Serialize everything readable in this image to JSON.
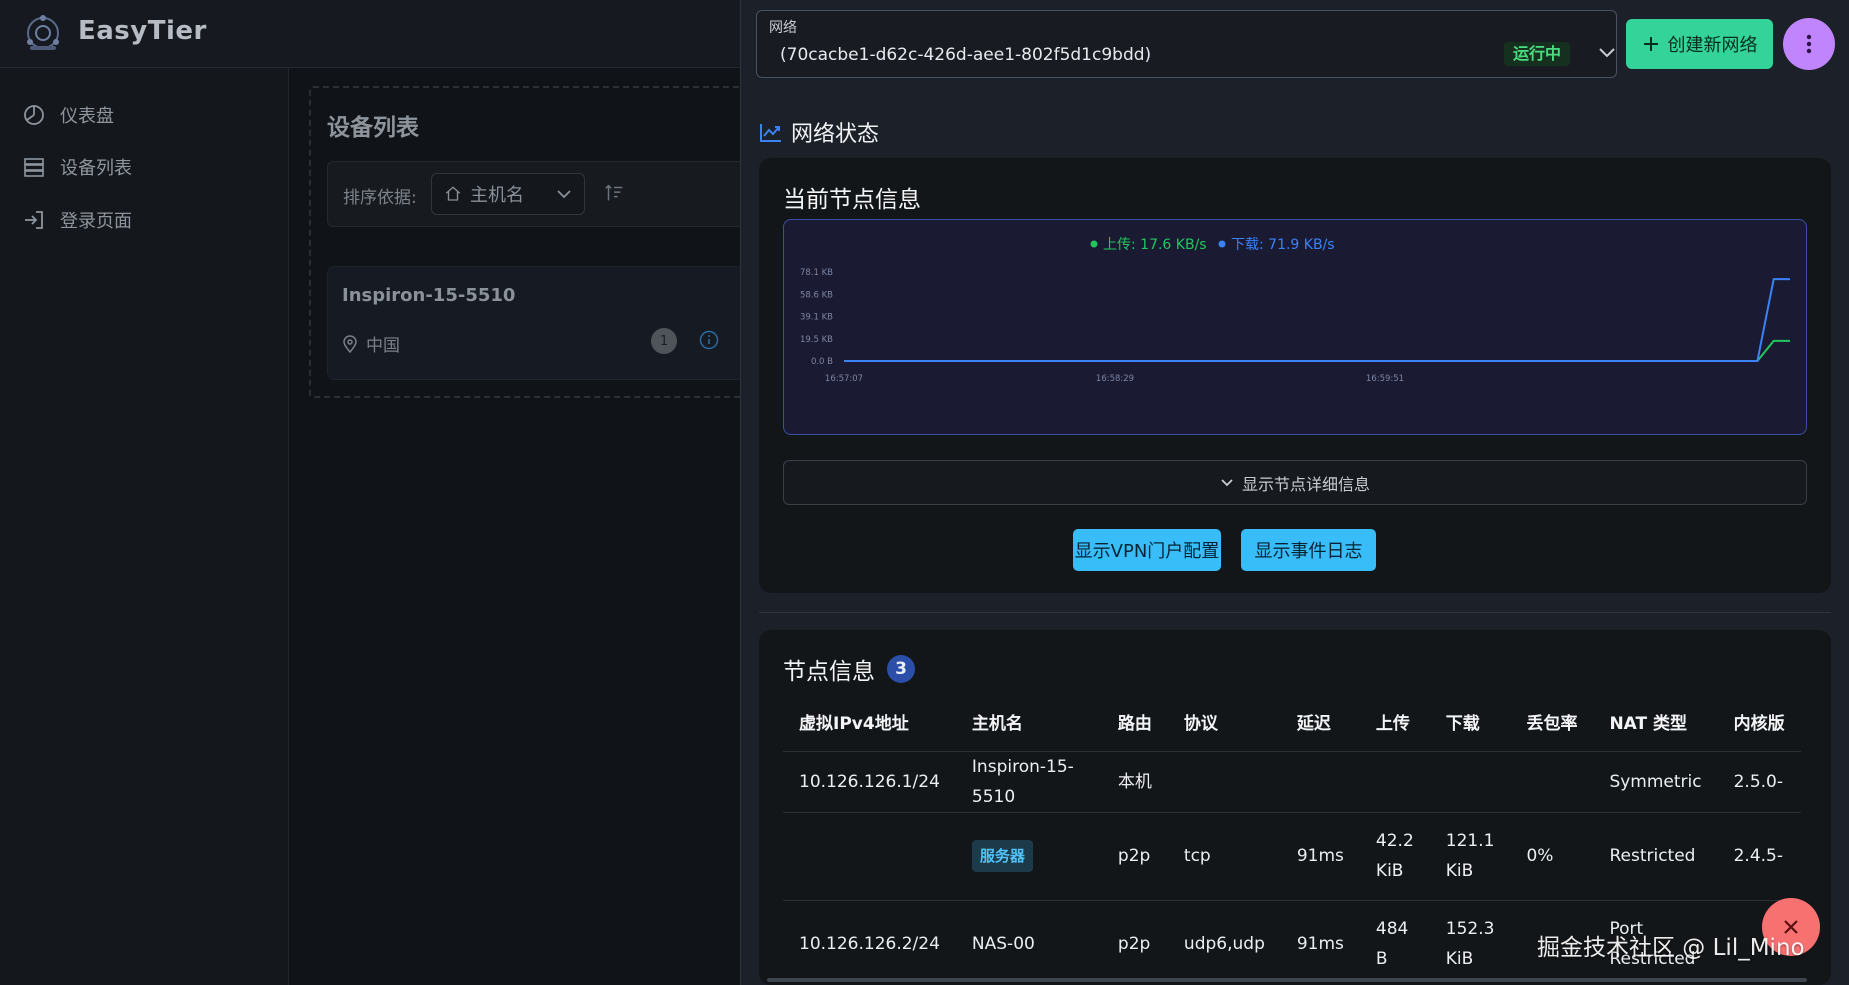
{
  "app": {
    "brand": "EasyTier"
  },
  "sidebar": {
    "items": [
      {
        "label": "仪表盘",
        "icon": "dashboard-icon"
      },
      {
        "label": "设备列表",
        "icon": "server-list-icon"
      },
      {
        "label": "登录页面",
        "icon": "login-icon"
      }
    ]
  },
  "devices": {
    "title": "设备列表",
    "sort_label": "排序依据:",
    "sort_value": "主机名",
    "card": {
      "name": "Inspiron-15-5510",
      "location": "中国",
      "count": "1"
    }
  },
  "network": {
    "select_label": "网络",
    "select_value": "(70cacbe1-d62c-426d-aee1-802f5d1c9bdd)",
    "status": "运行中",
    "create_button": "创建新网络"
  },
  "status": {
    "section_title": "网络状态",
    "node_info_title": "当前节点信息",
    "detail_button": "显示节点详细信息",
    "vpn_button": "显示VPN门户配置",
    "log_button": "显示事件日志"
  },
  "chart_data": {
    "type": "line",
    "legend": [
      "上传: 17.6 KB/s",
      "下载: 71.9 KB/s"
    ],
    "y_ticks": [
      "78.1 KB",
      "58.6 KB",
      "39.1 KB",
      "19.5 KB",
      "0.0 B"
    ],
    "x_ticks": [
      "16:57:07",
      "16:58:29",
      "16:59:51"
    ],
    "ylim": [
      0,
      78.1
    ],
    "series": [
      {
        "name": "上传",
        "color": "#22c55e",
        "values": [
          0,
          0,
          0,
          0,
          0,
          0,
          0,
          0,
          0,
          0,
          0,
          0,
          0,
          0,
          0,
          0,
          0,
          0,
          0,
          0,
          0,
          0,
          0,
          0,
          0,
          0,
          0,
          0,
          0,
          0,
          0,
          0,
          0,
          0,
          0,
          0,
          0,
          0,
          0,
          0,
          0,
          0,
          0,
          0,
          0,
          0,
          0,
          0,
          0,
          0,
          0,
          0,
          0,
          0,
          0,
          0,
          0,
          17.6,
          17.6
        ]
      },
      {
        "name": "下载",
        "color": "#3b82f6",
        "values": [
          0,
          0,
          0,
          0,
          0,
          0,
          0,
          0,
          0,
          0,
          0,
          0,
          0,
          0,
          0,
          0,
          0,
          0,
          0,
          0,
          0,
          0,
          0,
          0,
          0,
          0,
          0,
          0,
          0,
          0,
          0,
          0,
          0,
          0,
          0,
          0,
          0,
          0,
          0,
          0,
          0,
          0,
          0,
          0,
          0,
          0,
          0,
          0,
          0,
          0,
          0,
          0,
          0,
          0,
          0,
          0,
          0,
          71.9,
          71.9
        ]
      }
    ]
  },
  "peers": {
    "title": "节点信息",
    "count": "3",
    "columns": [
      "虚拟IPv4地址",
      "主机名",
      "路由",
      "协议",
      "延迟",
      "上传",
      "下载",
      "丢包率",
      "NAT 类型",
      "内核版"
    ],
    "rows": [
      [
        "10.126.126.1/24",
        "Inspiron-15-5510",
        "本机",
        "",
        "",
        "",
        "",
        "",
        "Symmetric",
        "2.5.0-"
      ],
      [
        "",
        "服务器",
        "p2p",
        "tcp",
        "91ms",
        "42.2 KiB",
        "121.1 KiB",
        "0%",
        "Restricted",
        "2.4.5-"
      ],
      [
        "10.126.126.2/24",
        "NAS-00",
        "p2p",
        "udp6,udp",
        "91ms",
        "484 B",
        "152.3 KiB",
        "",
        "Port Restricted",
        ""
      ]
    ]
  },
  "watermark": "掘金技术社区 @ Lil_Mino"
}
